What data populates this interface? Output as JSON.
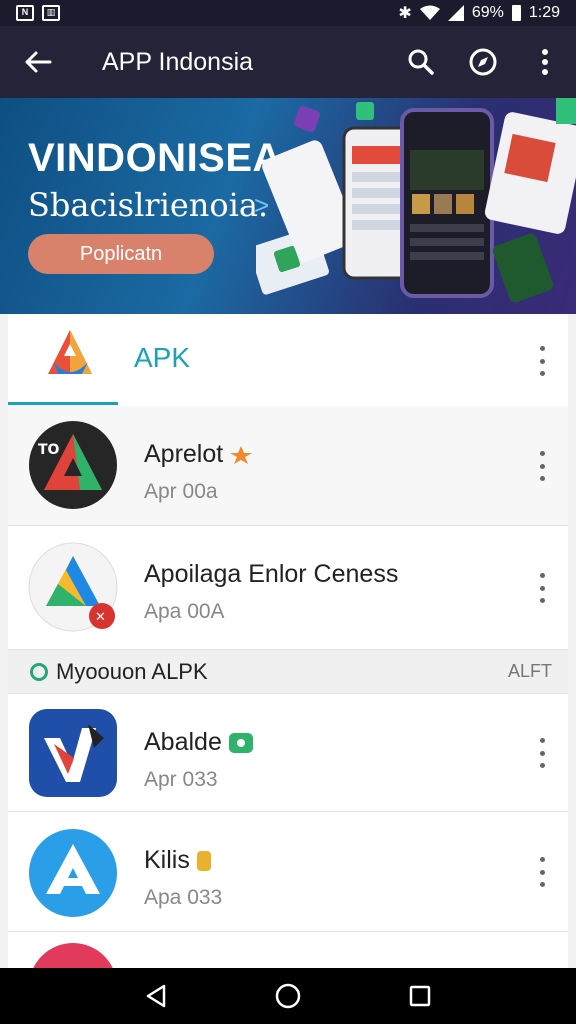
{
  "status_bar": {
    "left_icons": [
      "sim-icon",
      "image-icon"
    ],
    "battery": "69%",
    "time": "1:29"
  },
  "app_bar": {
    "title": "APP Indonsia",
    "back_icon": "arrow-left-icon",
    "actions": [
      "search-icon",
      "compass-icon",
      "more-vert-icon"
    ]
  },
  "banner": {
    "headline": "VINDONISEA",
    "subtitle": "Sbacislrienoia.",
    "arrow": ">",
    "cta_label": "Poplicatn",
    "colors": {
      "bg_start": "#0e4f82",
      "bg_end": "#3b2a78",
      "cta": "#d9826b"
    }
  },
  "list": {
    "header": {
      "label": "APK",
      "accent": "#1aa3b5"
    },
    "items_top": [
      {
        "name": "Aprelot",
        "meta": "Apr 00a",
        "badge": "orange-star-icon"
      },
      {
        "name": "Apoilaga Enlor Ceness",
        "meta": "Apa 00A",
        "badge": "red-close-badge"
      }
    ],
    "section": {
      "title": "Myoouon ALPK",
      "right": "ALFT"
    },
    "items_bottom": [
      {
        "name": "Abalde",
        "meta": "Apr 033",
        "badge": "green-badge-icon"
      },
      {
        "name": "Kilis",
        "meta": "Apa 033",
        "badge": "yellow-badge-icon"
      }
    ]
  },
  "nav_bar": [
    "back-triangle-icon",
    "home-circle-icon",
    "recents-square-icon"
  ]
}
